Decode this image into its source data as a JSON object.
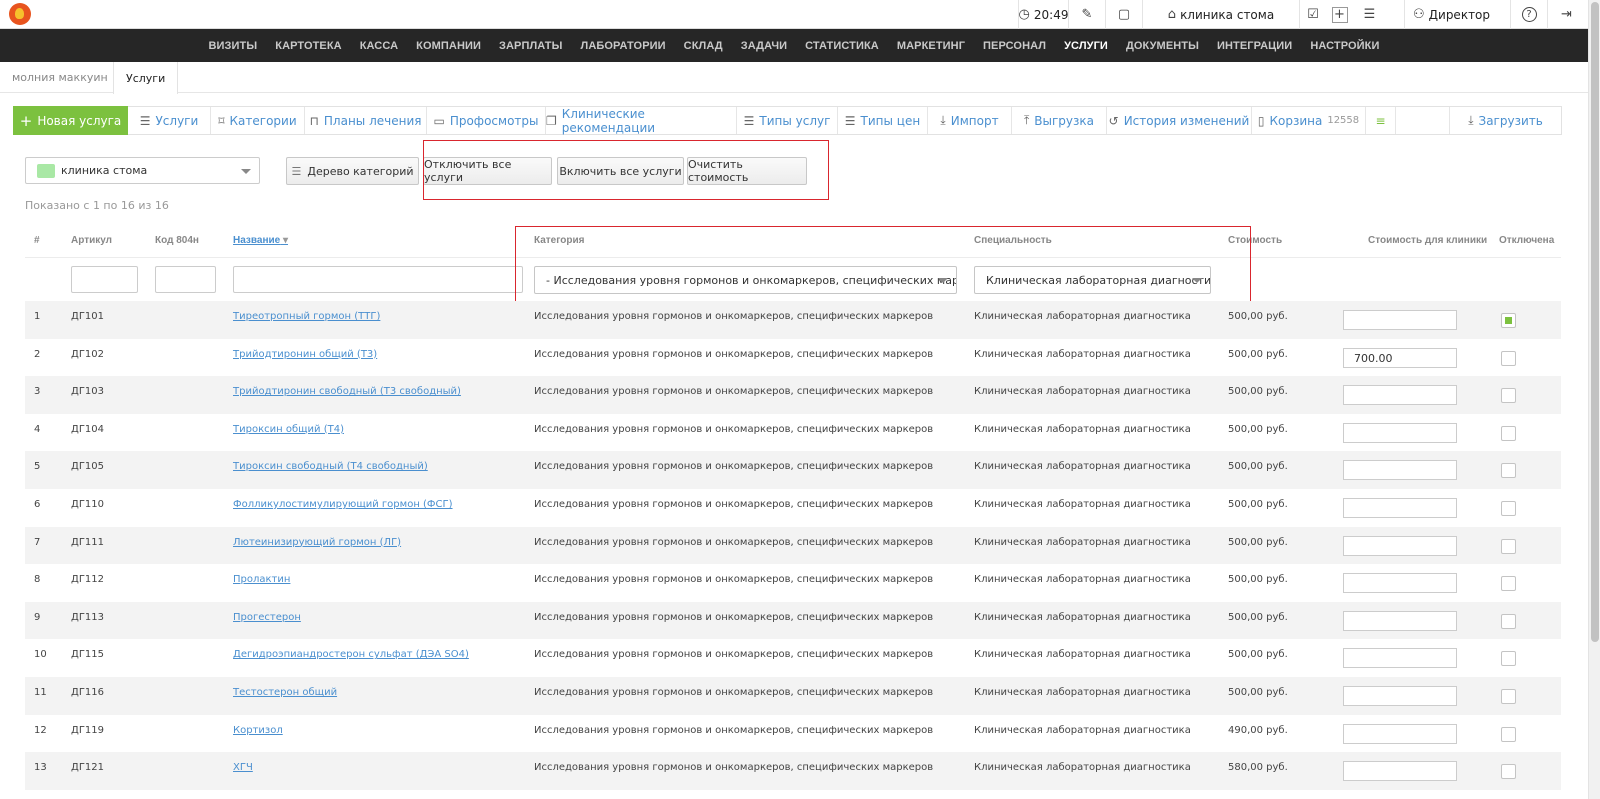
{
  "topbar": {
    "time": "20:49",
    "clinic": "клиника стома",
    "user": "Директор"
  },
  "mainnav": [
    "ВИЗИТЫ",
    "КАРТОТЕКА",
    "КАССА",
    "КОМПАНИИ",
    "ЗАРПЛАТЫ",
    "ЛАБОРАТОРИИ",
    "СКЛАД",
    "ЗАДАЧИ",
    "СТАТИСТИКА",
    "МАРКЕТИНГ",
    "ПЕРСОНАЛ",
    "УСЛУГИ",
    "ДОКУМЕНТЫ",
    "ИНТЕГРАЦИИ",
    "НАСТРОЙКИ"
  ],
  "mainnav_active": "УСЛУГИ",
  "breadcrumbs": {
    "first": "молния маккуин",
    "current": "Услуги"
  },
  "tabs": {
    "new": "Новая услуга",
    "services": "Услуги",
    "categories": "Категории",
    "plans": "Планы лечения",
    "checkups": "Профосмотры",
    "recommendations": "Клинические рекомендации",
    "service_types": "Типы услуг",
    "price_types": "Типы цен",
    "import": "Импорт",
    "export": "Выгрузка",
    "history": "История изменений",
    "trash": "Корзина",
    "trash_count": "12558",
    "upload": "Загрузить"
  },
  "controls": {
    "clinic_select": "клиника стома",
    "tree": "Дерево категорий",
    "disable_all": "Отключить все услуги",
    "enable_all": "Включить все услуги",
    "clear_cost": "Очистить стоимость"
  },
  "shown": "Показано с 1 по 16 из 16",
  "columns": {
    "num": "#",
    "article": "Артикул",
    "code": "Код 804н",
    "name": "Название",
    "category": "Категория",
    "specialty": "Специальность",
    "cost": "Стоимость",
    "clinic_cost": "Стоимость для клиники",
    "disabled": "Отключена"
  },
  "filters": {
    "category": "- Исследования уровня гормонов и онкомаркеров, специфических маркеров",
    "specialty": "Клиническая лабораторная диагностика"
  },
  "rows": [
    {
      "n": "1",
      "art": "ДГ101",
      "name": "Тиреотропный гормон (ТТГ)",
      "cat": "Исследования уровня гормонов и онкомаркеров, специфических маркеров",
      "spec": "Клиническая лабораторная диагностика",
      "cost": "500,00 руб.",
      "clinic": "",
      "disabled": true
    },
    {
      "n": "2",
      "art": "ДГ102",
      "name": "Трийодтиронин общий (Т3)",
      "cat": "Исследования уровня гормонов и онкомаркеров, специфических маркеров",
      "spec": "Клиническая лабораторная диагностика",
      "cost": "500,00 руб.",
      "clinic": "700.00",
      "disabled": false
    },
    {
      "n": "3",
      "art": "ДГ103",
      "name": "Трийодтиронин свободный (Т3 свободный)",
      "cat": "Исследования уровня гормонов и онкомаркеров, специфических маркеров",
      "spec": "Клиническая лабораторная диагностика",
      "cost": "500,00 руб.",
      "clinic": "",
      "disabled": false
    },
    {
      "n": "4",
      "art": "ДГ104",
      "name": "Тироксин общий (Т4)",
      "cat": "Исследования уровня гормонов и онкомаркеров, специфических маркеров",
      "spec": "Клиническая лабораторная диагностика",
      "cost": "500,00 руб.",
      "clinic": "",
      "disabled": false
    },
    {
      "n": "5",
      "art": "ДГ105",
      "name": "Тироксин свободный (Т4 свободный)",
      "cat": "Исследования уровня гормонов и онкомаркеров, специфических маркеров",
      "spec": "Клиническая лабораторная диагностика",
      "cost": "500,00 руб.",
      "clinic": "",
      "disabled": false
    },
    {
      "n": "6",
      "art": "ДГ110",
      "name": "Фолликулостимулирующий гормон (ФСГ)",
      "cat": "Исследования уровня гормонов и онкомаркеров, специфических маркеров",
      "spec": "Клиническая лабораторная диагностика",
      "cost": "500,00 руб.",
      "clinic": "",
      "disabled": false
    },
    {
      "n": "7",
      "art": "ДГ111",
      "name": "Лютеинизирующий гормон (ЛГ)",
      "cat": "Исследования уровня гормонов и онкомаркеров, специфических маркеров",
      "spec": "Клиническая лабораторная диагностика",
      "cost": "500,00 руб.",
      "clinic": "",
      "disabled": false
    },
    {
      "n": "8",
      "art": "ДГ112",
      "name": "Пролактин",
      "cat": "Исследования уровня гормонов и онкомаркеров, специфических маркеров",
      "spec": "Клиническая лабораторная диагностика",
      "cost": "500,00 руб.",
      "clinic": "",
      "disabled": false
    },
    {
      "n": "9",
      "art": "ДГ113",
      "name": "Прогестерон",
      "cat": "Исследования уровня гормонов и онкомаркеров, специфических маркеров",
      "spec": "Клиническая лабораторная диагностика",
      "cost": "500,00 руб.",
      "clinic": "",
      "disabled": false
    },
    {
      "n": "10",
      "art": "ДГ115",
      "name": "Дегидроэпиандростерон сульфат (ДЭА SO4)",
      "cat": "Исследования уровня гормонов и онкомаркеров, специфических маркеров",
      "spec": "Клиническая лабораторная диагностика",
      "cost": "500,00 руб.",
      "clinic": "",
      "disabled": false
    },
    {
      "n": "11",
      "art": "ДГ116",
      "name": "Тестостерон общий",
      "cat": "Исследования уровня гормонов и онкомаркеров, специфических маркеров",
      "spec": "Клиническая лабораторная диагностика",
      "cost": "500,00 руб.",
      "clinic": "",
      "disabled": false
    },
    {
      "n": "12",
      "art": "ДГ119",
      "name": "Кортизол",
      "cat": "Исследования уровня гормонов и онкомаркеров, специфических маркеров",
      "spec": "Клиническая лабораторная диагностика",
      "cost": "490,00 руб.",
      "clinic": "",
      "disabled": false
    },
    {
      "n": "13",
      "art": "ДГ121",
      "name": "ХГЧ",
      "cat": "Исследования уровня гормонов и онкомаркеров, специфических маркеров",
      "spec": "Клиническая лабораторная диагностика",
      "cost": "580,00 руб.",
      "clinic": "",
      "disabled": false
    }
  ],
  "colors": {
    "accent": "#4a8fcf",
    "green": "#7cc13f",
    "nav": "#262626",
    "highlight": "#d9262e"
  }
}
